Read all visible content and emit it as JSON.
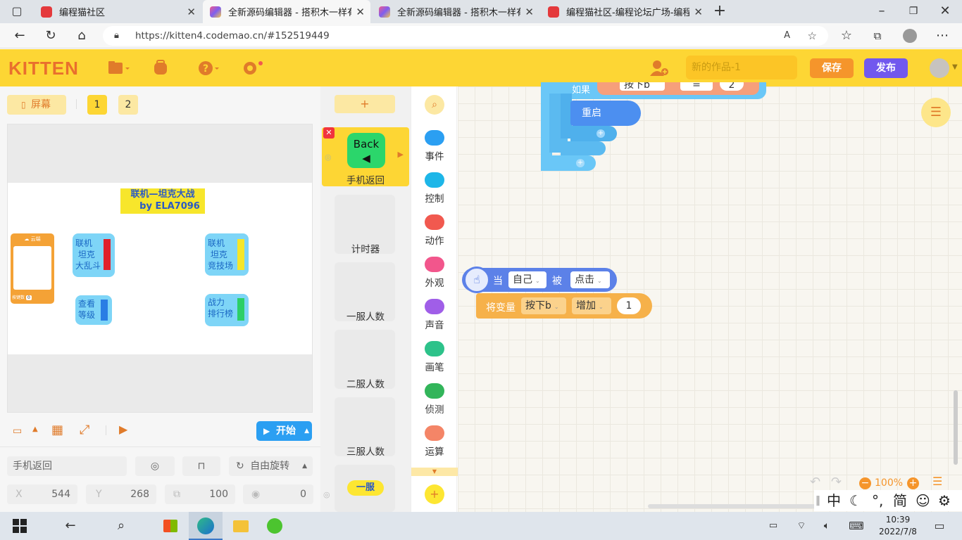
{
  "tabs": [
    {
      "title": "编程猫社区",
      "active": false
    },
    {
      "title": "全新源码编辑器 - 搭积木一样有趣",
      "active": true
    },
    {
      "title": "全新源码编辑器 - 搭积木一样有趣",
      "active": false
    },
    {
      "title": "编程猫社区-编程论坛广场-编程学",
      "active": false
    }
  ],
  "url": "https://kitten4.codemao.cn/#152519449",
  "header": {
    "logo": "KITTEN",
    "project_name": "新的作品-1",
    "save_label": "保存",
    "publish_label": "发布"
  },
  "stage_toolbar": {
    "screen_label": "屏幕",
    "screen_tabs": [
      "1",
      "2"
    ]
  },
  "stage": {
    "title_line1": "联机—坦克大战",
    "title_line2": "by ELA7096",
    "buttons": [
      {
        "text": "联机\n 坦克\n大乱斗",
        "bar_color": "#e0202a"
      },
      {
        "text": "联机\n 坦克\n竞技场",
        "bar_color": "#f5e629"
      },
      {
        "text": "查看\n等级",
        "bar_color": "#2a7de4"
      },
      {
        "text": "战力\n排行榜",
        "bar_color": "#2ccf67"
      }
    ],
    "joystick_label": "☁ 云端",
    "mini_label": "按键数",
    "mini_value": "0"
  },
  "start_label": "开始",
  "sprite_props": {
    "name": "手机返回",
    "rotation": "自由旋转",
    "x_label": "X",
    "x": "544",
    "y_label": "Y",
    "y": "268",
    "size": "100",
    "direction": "0"
  },
  "sprites": {
    "add_label": "+",
    "selected": {
      "name": "手机返回",
      "thumb_text": "Back"
    },
    "list": [
      "计时器",
      "一服人数",
      "二服人数",
      "三服人数"
    ],
    "last_label": "一服"
  },
  "categories": [
    {
      "label": "事件",
      "color": "#2b9ff2"
    },
    {
      "label": "控制",
      "color": "#1db6e8"
    },
    {
      "label": "动作",
      "color": "#f1594f"
    },
    {
      "label": "外观",
      "color": "#f2568c"
    },
    {
      "label": "声音",
      "color": "#a05ee8"
    },
    {
      "label": "画笔",
      "color": "#2dc28a"
    },
    {
      "label": "侦测",
      "color": "#32b55a"
    },
    {
      "label": "运算",
      "color": "#f48567"
    }
  ],
  "blocks": {
    "top_partial": {
      "if_label": "如果",
      "var": "按下b",
      "op": "=",
      "value": "2"
    },
    "restart_label": "重启",
    "event": {
      "when": "当",
      "target": "自己",
      "by": "被",
      "action": "点击"
    },
    "setvar": {
      "label": "将变量",
      "var": "按下b",
      "op": "增加",
      "value": "1"
    }
  },
  "zoom": "100%",
  "taskbar": {
    "time": "10:39",
    "date": "2022/7/8",
    "ime": [
      "中",
      "°,",
      "简"
    ]
  }
}
